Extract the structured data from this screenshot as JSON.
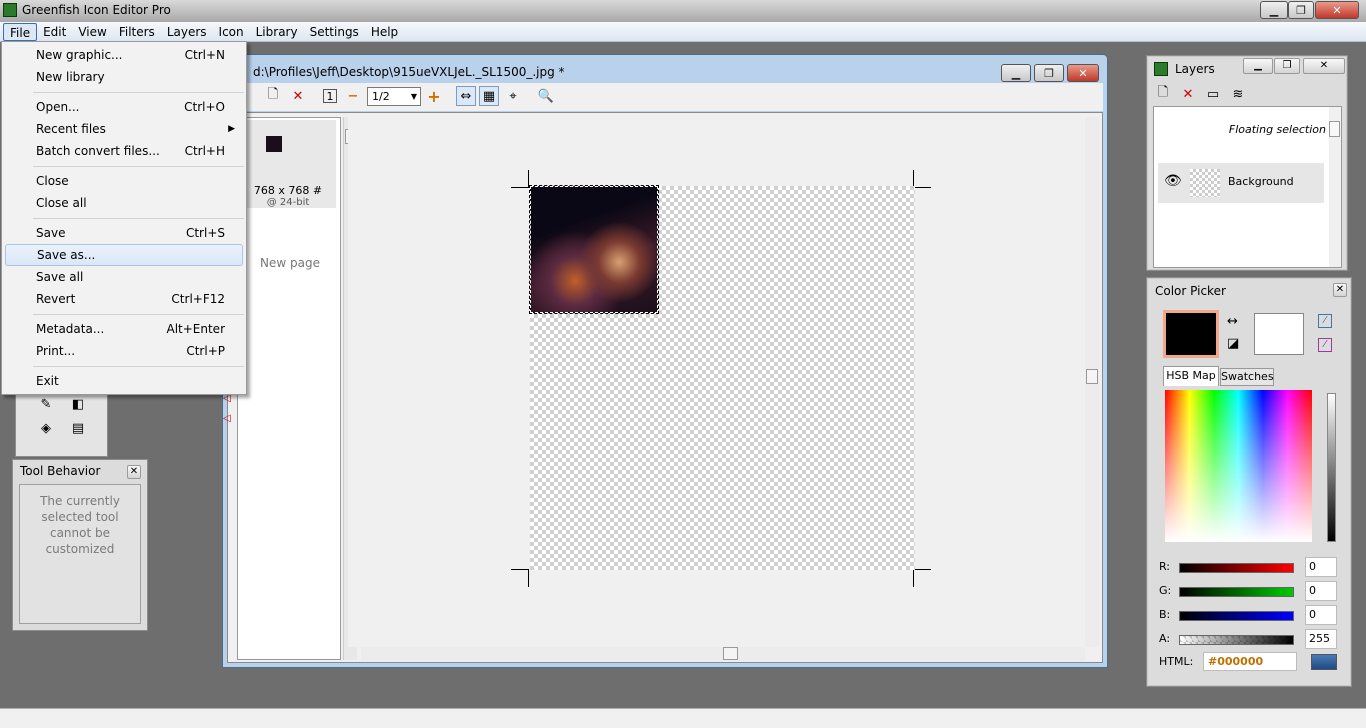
{
  "app": {
    "title": "Greenfish Icon Editor Pro"
  },
  "menubar": [
    "File",
    "Edit",
    "View",
    "Filters",
    "Layers",
    "Icon",
    "Library",
    "Settings",
    "Help"
  ],
  "file_menu": {
    "items": [
      {
        "label": "New graphic...",
        "shortcut": "Ctrl+N"
      },
      {
        "label": "New library",
        "shortcut": ""
      },
      {
        "label": "Open...",
        "shortcut": "Ctrl+O"
      },
      {
        "label": "Recent files",
        "shortcut": ""
      },
      {
        "label": "Batch convert files...",
        "shortcut": "Ctrl+H"
      },
      {
        "label": "Close",
        "shortcut": ""
      },
      {
        "label": "Close all",
        "shortcut": ""
      },
      {
        "label": "Save",
        "shortcut": "Ctrl+S"
      },
      {
        "label": "Save as...",
        "shortcut": ""
      },
      {
        "label": "Save all",
        "shortcut": ""
      },
      {
        "label": "Revert",
        "shortcut": "Ctrl+F12"
      },
      {
        "label": "Metadata...",
        "shortcut": "Alt+Enter"
      },
      {
        "label": "Print...",
        "shortcut": "Ctrl+P"
      },
      {
        "label": "Exit",
        "shortcut": ""
      }
    ],
    "highlighted": "Save as..."
  },
  "document": {
    "title": "d:\\Profiles\\Jeff\\Desktop\\915ueVXLJeL._SL1500_.jpg *",
    "zoom": "1/2",
    "page_size": "768 x 768 #",
    "page_depth": "@ 24-bit",
    "new_page": "New page"
  },
  "layers": {
    "title": "Layers",
    "items": [
      "Floating selection",
      "Background"
    ]
  },
  "color_picker": {
    "title": "Color Picker",
    "tabs": [
      "HSB Map",
      "Swatches"
    ],
    "primary_color": "#000000",
    "secondary_color": "#ffffff",
    "r_label": "R:",
    "r": "0",
    "g_label": "G:",
    "g": "0",
    "b_label": "B:",
    "b": "0",
    "a_label": "A:",
    "a": "255",
    "html_label": "HTML:",
    "html": "#000000"
  },
  "tool_behavior": {
    "title": "Tool Behavior",
    "text": "The currently selected tool cannot be customized"
  }
}
